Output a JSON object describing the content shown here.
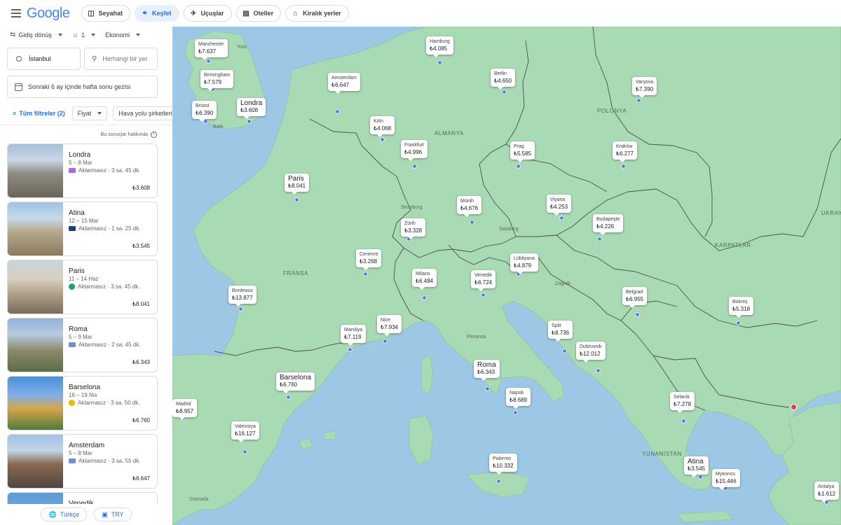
{
  "header": {
    "logo": "Google",
    "tabs": [
      {
        "label": "Seyahat",
        "icon": "luggage-icon"
      },
      {
        "label": "Keşfet",
        "icon": "explore-icon",
        "active": true
      },
      {
        "label": "Uçuşlar",
        "icon": "plane-icon"
      },
      {
        "label": "Oteller",
        "icon": "bed-icon"
      },
      {
        "label": "Kiralık yerler",
        "icon": "home-icon"
      }
    ]
  },
  "search": {
    "trip_type": "Gidiş dönüş",
    "passengers": "1",
    "cabin": "Ekonomi",
    "origin": "İstanbul",
    "destination_placeholder": "Herhangi bir yer",
    "dates": "Sonraki 6 ay içinde hafta sonu gezisi"
  },
  "filters": {
    "all": "Tüm filtreler (2)",
    "price": "Fiyat",
    "airlines": "Hava yolu şirketleri"
  },
  "about_results": "Bu sonuçlar hakkında",
  "results": [
    {
      "city": "Londra",
      "dates": "5 – 8 Mar",
      "stops": "Aktarmasız · 3 sa. 45 dk.",
      "price": "₺3.608",
      "airline_color": "#b06ad8"
    },
    {
      "city": "Atina",
      "dates": "12 – 15 Mar",
      "stops": "Aktarmasız · 1 sa. 25 dk.",
      "price": "₺3.545",
      "airline_color": "#1b3f7a"
    },
    {
      "city": "Paris",
      "dates": "11 – 14 Haz",
      "stops": "Aktarmasız · 3 sa. 45 dk.",
      "price": "₺8.041",
      "airline_color": "#1ea362"
    },
    {
      "city": "Roma",
      "dates": "5 – 9 Mar",
      "stops": "Aktarmasız · 2 sa. 45 dk.",
      "price": "₺6.343",
      "airline_color": "#6c8fd6"
    },
    {
      "city": "Barselona",
      "dates": "16 – 19 Nis",
      "stops": "Aktarmasız · 3 sa. 50 dk.",
      "price": "₺6.760",
      "airline_color": "#f2b400"
    },
    {
      "city": "Amsterdam",
      "dates": "5 – 8 Mar",
      "stops": "Aktarmasız · 3 sa. 55 dk.",
      "price": "₺6.647",
      "airline_color": "#6c8fd6"
    },
    {
      "city": "Venedik",
      "dates": "",
      "stops": "",
      "price": "",
      "airline_color": "#6c8fd6"
    }
  ],
  "footer": {
    "language": "Türkçe",
    "currency": "TRY"
  },
  "map": {
    "price_labels": [
      {
        "city": "Manchester",
        "price": "₺7.637"
      },
      {
        "city": "Birmingham",
        "price": "₺7.579"
      },
      {
        "city": "Bristol",
        "price": "₺6.390"
      },
      {
        "city": "Londra",
        "price": "₺3.608"
      },
      {
        "city": "Hamburg",
        "price": "₺4.085"
      },
      {
        "city": "Amsterdam",
        "price": "₺6.647"
      },
      {
        "city": "Berlin",
        "price": "₺4.650"
      },
      {
        "city": "Varşova",
        "price": "₺7.390"
      },
      {
        "city": "Köln",
        "price": "₺4.068"
      },
      {
        "city": "Frankfurt",
        "price": "₺4.996"
      },
      {
        "city": "Prag",
        "price": "₺5.585"
      },
      {
        "city": "Kraków",
        "price": "₺6.277"
      },
      {
        "city": "Paris",
        "price": "₺8.041"
      },
      {
        "city": "Münih",
        "price": "₺4.676"
      },
      {
        "city": "Viyana",
        "price": "₺4.253"
      },
      {
        "city": "Zürih",
        "price": "₺3.328"
      },
      {
        "city": "Budapeşte",
        "price": "₺4.226"
      },
      {
        "city": "Cenevre",
        "price": "₺3.268"
      },
      {
        "city": "Lübliyana",
        "price": "₺4.879"
      },
      {
        "city": "Milano",
        "price": "₺6.484"
      },
      {
        "city": "Venedik",
        "price": "₺6.724"
      },
      {
        "city": "Bordeaux",
        "price": "₺13.877"
      },
      {
        "city": "Belgrad",
        "price": "₺6.955"
      },
      {
        "city": "Bükreş",
        "price": "₺5.318"
      },
      {
        "city": "Nice",
        "price": "₺7.934"
      },
      {
        "city": "Marsilya",
        "price": "₺7.119"
      },
      {
        "city": "Split",
        "price": "₺8.736"
      },
      {
        "city": "Dubrovnik",
        "price": "₺12.012"
      },
      {
        "city": "Roma",
        "price": "₺6.343"
      },
      {
        "city": "Barselona",
        "price": "₺6.760"
      },
      {
        "city": "Madrid",
        "price": "₺8.957"
      },
      {
        "city": "Napoli",
        "price": "₺8.689"
      },
      {
        "city": "Selanik",
        "price": "₺7.278"
      },
      {
        "city": "Valensiya",
        "price": "₺16.127"
      },
      {
        "city": "Palermo",
        "price": "₺10.332"
      },
      {
        "city": "Atina",
        "price": "₺3.545"
      },
      {
        "city": "Mykonos",
        "price": "₺15.446"
      },
      {
        "city": "Antalya",
        "price": "₺1.612"
      }
    ],
    "country_labels": [
      "POLONYA",
      "ALMANYA",
      "FRANSA",
      "KARPATLAR",
      "YUNANİSTAN",
      "UKRAY"
    ],
    "city_labels": [
      "York",
      "Bath",
      "Strazburg",
      "Salzburg",
      "Zagreb",
      "Floransa",
      "Granada"
    ]
  }
}
